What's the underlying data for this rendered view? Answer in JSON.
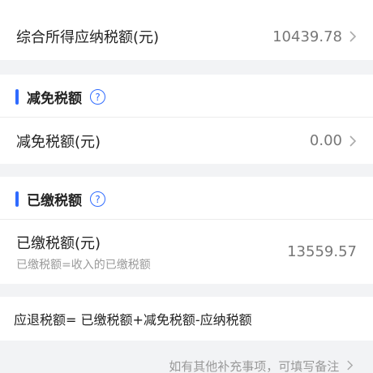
{
  "taxable_row": {
    "label": "综合所得应纳税额(元)",
    "value": "10439.78"
  },
  "reduction_section": {
    "title": "减免税额",
    "help_glyph": "?"
  },
  "reduction_row": {
    "label": "减免税额(元)",
    "value": "0.00"
  },
  "paid_section": {
    "title": "已缴税额",
    "help_glyph": "?"
  },
  "paid_row": {
    "label": "已缴税额(元)",
    "sub": "已缴税额=收入的已缴税额",
    "value": "13559.57"
  },
  "formula": "应退税额= 已缴税额+减免税额-应纳税额",
  "footer_hint": "如有其他补充事项，可填写备注",
  "colors": {
    "accent": "#2f6bff",
    "background": "#f2f3f5"
  }
}
